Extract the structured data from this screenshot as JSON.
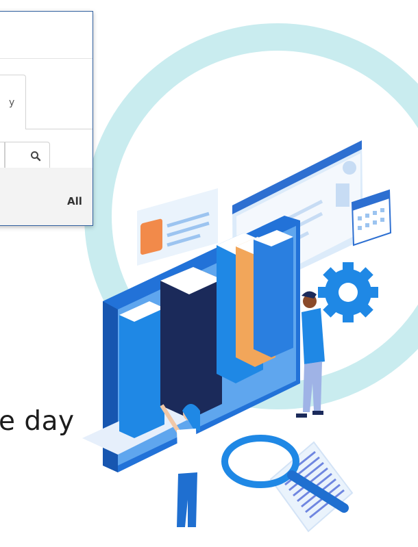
{
  "card": {
    "tab_label": "y",
    "filter_value": "All"
  },
  "tagline": "e day",
  "icons": {
    "search": "search-icon",
    "caret": "chevron-down-icon"
  },
  "colors": {
    "ring": "#c9ecef",
    "blue": "#1f88e5",
    "navy": "#1b2a5a",
    "orange": "#f2a65a",
    "border": "#2f5f9e"
  }
}
